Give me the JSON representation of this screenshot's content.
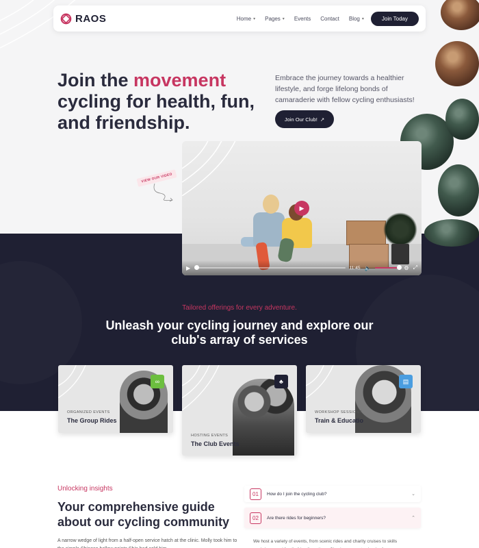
{
  "brand": {
    "name": "RAOS",
    "accent": "#c73661",
    "dark": "#1f2033"
  },
  "nav": {
    "items": [
      {
        "label": "Home",
        "dropdown": true
      },
      {
        "label": "Pages",
        "dropdown": true
      },
      {
        "label": "Events",
        "dropdown": false
      },
      {
        "label": "Contact",
        "dropdown": false
      },
      {
        "label": "Blog",
        "dropdown": true
      }
    ],
    "cta": "Join Today"
  },
  "hero": {
    "title_pre": "Join the ",
    "title_accent": "movement",
    "title_post": " cycling for health, fun, and friendship.",
    "text": "Embrace the journey towards a healthier lifestyle, and forge lifelong bonds of camaraderie with fellow cycling enthusiasts!",
    "cta": "Join Our Club!",
    "view_tag": "VIEW OUR VIDEO"
  },
  "video": {
    "time": "11:45",
    "progress": 0.0,
    "volume": 1.0,
    "icons": [
      "play-icon",
      "volume-icon",
      "settings-icon",
      "fullscreen-icon"
    ]
  },
  "services": {
    "tag": "Tailored offerings for every adventure.",
    "title": "Unleash your cycling journey and explore our club's array of services",
    "cards": [
      {
        "label": "ORGANIZED EVENTS",
        "title": "The Group Rides",
        "icon": "cycling-icon",
        "icon_color": "#6cbf3f"
      },
      {
        "label": "HOSTING EVENTS",
        "title": "The Club Events",
        "icon": "event-icon",
        "icon_color": "#1f2033"
      },
      {
        "label": "WORKSHOP SESSIONS",
        "title": "Train & Educatio",
        "icon": "workshop-icon",
        "icon_color": "#4a9de0"
      }
    ]
  },
  "insights": {
    "tag": "Unlocking insights",
    "title": "Your comprehensive guide about our cycling community",
    "text": "A narrow wedge of light from a half-open service hatch at the clinic. Molly took him to the simple Chinese hollow points Shin had sold him."
  },
  "faq": [
    {
      "num": "01",
      "question": "How do I join the cycling club?",
      "open": false
    },
    {
      "num": "02",
      "question": "Are there rides for beginners?",
      "open": true,
      "answer": "We host a variety of events, from scenic rides and charity cruises to skills workshops and family-friendly outings. Check our event calendar for more."
    }
  ]
}
